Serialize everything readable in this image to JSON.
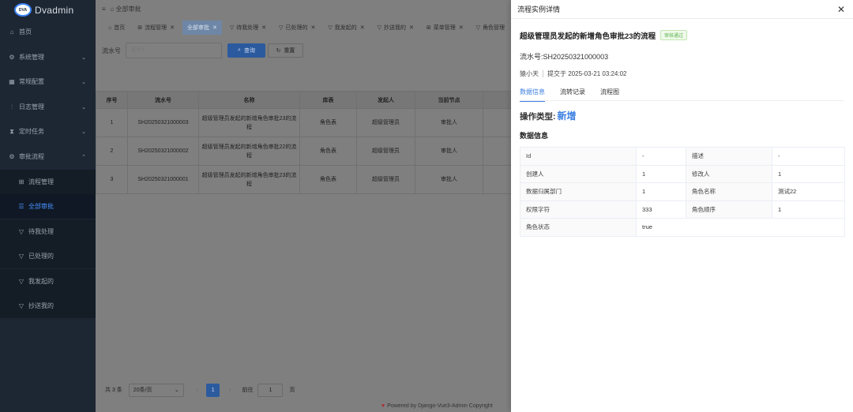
{
  "brand": {
    "badge": "DVA",
    "name": "Dvadmin"
  },
  "sidebar": {
    "items": [
      {
        "label": "首页",
        "icon": "home-icon",
        "glyph": "⌂",
        "chevron": ""
      },
      {
        "label": "系统管理",
        "icon": "gear-icon",
        "glyph": "⚙",
        "chevron": "⌄"
      },
      {
        "label": "常规配置",
        "icon": "grid-icon",
        "glyph": "▦",
        "chevron": "⌄"
      },
      {
        "label": "日志管理",
        "icon": "chart-icon",
        "glyph": "⫶",
        "chevron": "⌄"
      },
      {
        "label": "定时任务",
        "icon": "clock-icon",
        "glyph": "⧗",
        "chevron": "⌄"
      },
      {
        "label": "审批流程",
        "icon": "flow-icon",
        "glyph": "⚙",
        "chevron": "⌃"
      }
    ],
    "subitems": [
      {
        "label": "流程管理",
        "icon": "apps-icon",
        "glyph": "⊞"
      },
      {
        "label": "全部审批",
        "icon": "list-icon",
        "glyph": "☰"
      },
      {
        "label": "待我处理",
        "icon": "filter-icon",
        "glyph": "▽"
      },
      {
        "label": "已处理的",
        "icon": "filter-icon",
        "glyph": "▽"
      },
      {
        "label": "我发起的",
        "icon": "filter-icon",
        "glyph": "▽"
      },
      {
        "label": "抄送我的",
        "icon": "filter-icon",
        "glyph": "▽"
      }
    ]
  },
  "topbar": {
    "menu_glyph": "≡",
    "breadcrumb_glyph": "⌂",
    "breadcrumb": "全部审批"
  },
  "tabs": [
    {
      "label": "首页",
      "glyph": "⌂",
      "close": ""
    },
    {
      "label": "流程管理",
      "glyph": "⊞",
      "close": "✕"
    },
    {
      "label": "全部审批",
      "glyph": "",
      "close": "✕"
    },
    {
      "label": "待我处理",
      "glyph": "▽",
      "close": "✕"
    },
    {
      "label": "已处理的",
      "glyph": "▽",
      "close": "✕"
    },
    {
      "label": "我发起的",
      "glyph": "▽",
      "close": "✕"
    },
    {
      "label": "抄送我的",
      "glyph": "▽",
      "close": "✕"
    },
    {
      "label": "菜单管理",
      "glyph": "⊞",
      "close": "✕"
    },
    {
      "label": "角色管理",
      "glyph": "▽",
      "close": ""
    }
  ],
  "search": {
    "label": "流水号",
    "placeholder": "流水号",
    "query_label": "查询",
    "reset_label": "重置",
    "query_glyph": "⌕",
    "reset_glyph": "↻"
  },
  "table": {
    "headers": [
      "序号",
      "流水号",
      "名称",
      "库表",
      "发起人",
      "当前节点",
      ""
    ],
    "rows": [
      [
        "1",
        "SH20250321000003",
        "超级管理员发起的新增角色审批23的流程",
        "角色表",
        "超级管理员",
        "审批人",
        ""
      ],
      [
        "2",
        "SH20250321000002",
        "超级管理员发起的新增角色审批22的流程",
        "角色表",
        "超级管理员",
        "审批人",
        ""
      ],
      [
        "3",
        "SH20250321000001",
        "超级管理员发起的新增角色审批23的流程",
        "角色表",
        "超级管理员",
        "审批人",
        ""
      ]
    ]
  },
  "pager": {
    "total": "共 3 条",
    "page_size": "20条/页",
    "prev": "‹",
    "current": "1",
    "next": "›",
    "goto_label": "前往",
    "goto_value": "1",
    "goto_suffix": "页"
  },
  "footer": {
    "text": "Powered by Django-Vue3-Admin Copyright"
  },
  "drawer": {
    "title": "流程实例详情",
    "close_glyph": "✕",
    "flow_title": "超级管理员发起的新增角色审批23的流程",
    "status": "审核通过",
    "serial": "流水号:SH20250321000003",
    "submitter": "猿小天",
    "submitted_at": "提交于 2025-03-21 03:24:02",
    "tabs": [
      "数据信息",
      "流转记录",
      "流程图"
    ],
    "op_label": "操作类型:",
    "op_value": "新增",
    "section": "数据信息",
    "rows": [
      [
        "Id",
        "-",
        "描述",
        "-"
      ],
      [
        "创建人",
        "1",
        "修改人",
        "1"
      ],
      [
        "数据归属部门",
        "1",
        "角色名称",
        "测试22"
      ],
      [
        "权限字符",
        "333",
        "角色顺序",
        "1"
      ],
      [
        "角色状态",
        "true",
        "",
        ""
      ]
    ]
  },
  "colors": {
    "sidebar_bg": "#1d2734",
    "accent": "#3b7fe0",
    "status_green": "#58b24a",
    "overlay": "#7f7f7f"
  }
}
